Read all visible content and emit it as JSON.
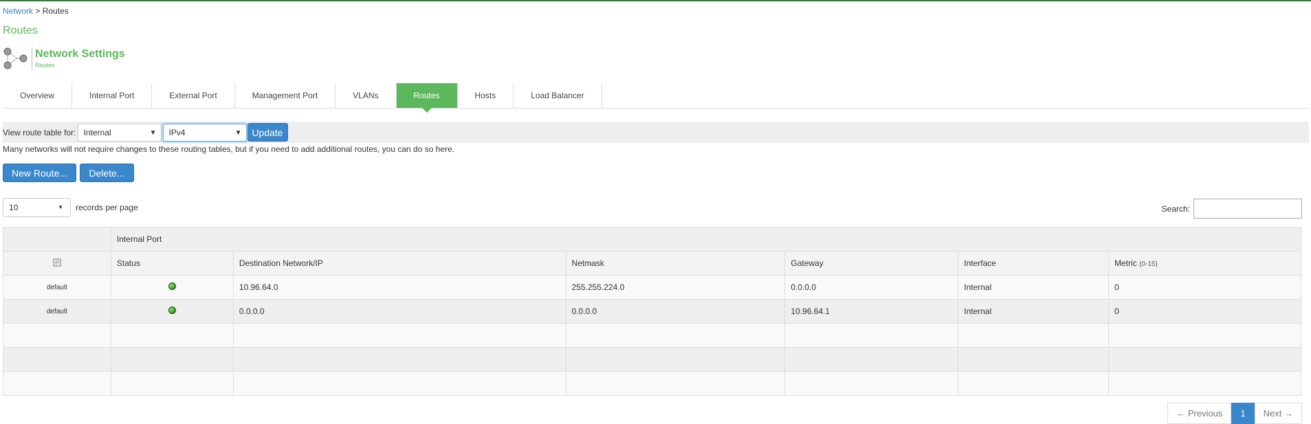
{
  "breadcrumb": {
    "parent": "Network",
    "separator": ">",
    "current": "Routes"
  },
  "page_title": "Routes",
  "header": {
    "title": "Network Settings",
    "subtitle": "Routes",
    "icon": "network-nodes-icon"
  },
  "tabs": [
    {
      "label": "Overview",
      "active": false
    },
    {
      "label": "Internal Port",
      "active": false
    },
    {
      "label": "External Port",
      "active": false
    },
    {
      "label": "Management Port",
      "active": false
    },
    {
      "label": "VLANs",
      "active": false
    },
    {
      "label": "Routes",
      "active": true
    },
    {
      "label": "Hosts",
      "active": false
    },
    {
      "label": "Load Balancer",
      "active": false
    }
  ],
  "filter": {
    "label": "View route table for:",
    "interface_value": "Internal",
    "ip_version_value": "IPv4",
    "update_label": "Update"
  },
  "info_text": "Many networks will not require changes to these routing tables, but if you need to add additional routes, you can do so here.",
  "actions": {
    "new_route": "New Route...",
    "delete": "Delete..."
  },
  "length": {
    "value": "10",
    "suffix": "records per page"
  },
  "search": {
    "label": "Search:",
    "value": ""
  },
  "table": {
    "group_header": "Internal Port",
    "columns": [
      "Status",
      "Destination Network/IP",
      "Netmask",
      "Gateway",
      "Interface",
      "Metric"
    ],
    "metric_hint": "(0-15)",
    "rows": [
      {
        "name": "default",
        "status": "active",
        "destination": "10.96.64.0",
        "netmask": "255.255.224.0",
        "gateway": "0.0.0.0",
        "interface": "Internal",
        "metric": "0"
      },
      {
        "name": "default",
        "status": "active",
        "destination": "0.0.0.0",
        "netmask": "0.0.0.0",
        "gateway": "10.96.64.1",
        "interface": "Internal",
        "metric": "0"
      }
    ]
  },
  "pagination": {
    "previous": "← Previous",
    "current": "1",
    "next": "Next →"
  },
  "colors": {
    "accent_green": "#5cb85c",
    "button_blue": "#3a87cc",
    "link_blue": "#3a7fc4",
    "status_green": "#2f8f1f"
  }
}
